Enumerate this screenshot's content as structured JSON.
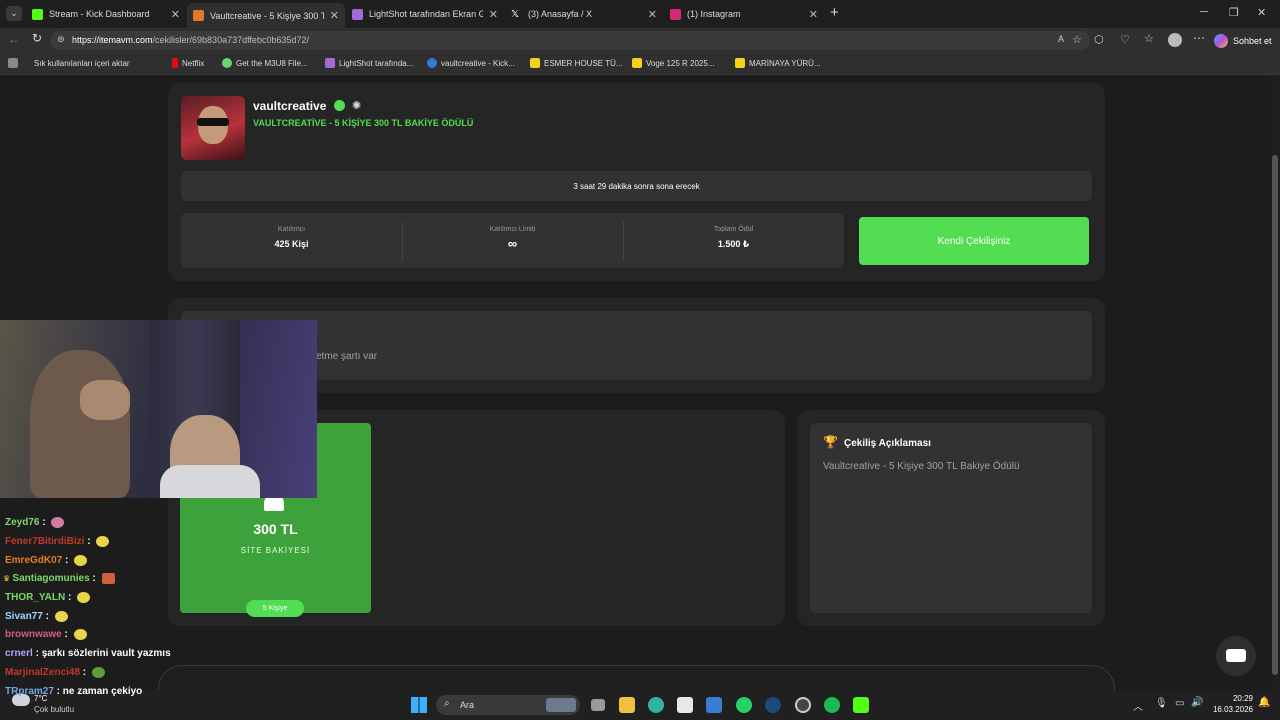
{
  "browser": {
    "tabs": [
      {
        "title": "Stream - Kick Dashboard",
        "color": "#53fc18"
      },
      {
        "title": "Vaultcreative - 5 Kişiye 300 TL Baki",
        "color": "#e07a2a"
      },
      {
        "title": "LightShot tarafından Ekran Görünt",
        "color": "#a36ad6"
      },
      {
        "title": "(3) Anasayfa / X",
        "color": "#ffffff"
      },
      {
        "title": "(1) Instagram",
        "color": "#d62976"
      }
    ],
    "new_tab": "+",
    "url_host": "https://itemavm.com",
    "url_path": "/cekilisler/69b830a737dffebc0b635d72/",
    "copilot": "Sohbet et",
    "bookmarks": [
      "Sık kullanılanları içeri aktar",
      "Netflix",
      "Get the M3U8 File...",
      "LightShot tarafında...",
      "vaultcreative - Kick...",
      "ESMER HOUSE TÜ...",
      "Voge 125 R 2025...",
      "MARİNAYA YÜRÜ..."
    ]
  },
  "giveaway": {
    "username": "vaultcreative",
    "subtitle": "VAULTCREATİVE - 5 KİŞİYE 300 TL BAKİYE ÖDÜLÜ",
    "countdown": "3 saat 29 dakika sonra sona erecek",
    "stats": [
      {
        "label": "Katılımcı",
        "value": "425 Kişi"
      },
      {
        "label": "Katılımcı Limiti",
        "value": "∞"
      },
      {
        "label": "Toplam Ödül",
        "value": "1.500 ₺"
      }
    ],
    "own_button": "Kendi Çekilişiniz",
    "requirement_text": "etme şartı var",
    "prize_amount": "300 TL",
    "prize_type": "SİTE BAKİYESİ",
    "prize_count": "5 Kişiye",
    "desc_title": "Çekiliş Açıklaması",
    "desc_text": "Vaultcreative - 5 Kişiye 300 TL Bakiye Ödülü"
  },
  "chat": [
    {
      "user": "Zeyd76",
      "msg": "",
      "color": "#7bd96a"
    },
    {
      "user": "Fener7BitirdiBizi",
      "msg": "",
      "color": "#c0392b"
    },
    {
      "user": "EmreGdK07",
      "msg": "",
      "color": "#e67e22"
    },
    {
      "user": "Santiagomunies",
      "msg": "",
      "color": "#7bd96a"
    },
    {
      "user": "THOR_YALN",
      "msg": "",
      "color": "#7bd96a"
    },
    {
      "user": "Sivan77",
      "msg": "",
      "color": "#9fd6ff"
    },
    {
      "user": "brownwawe",
      "msg": "",
      "color": "#d85a8f"
    },
    {
      "user": "crnerl",
      "msg": "şarkı sözlerini vault yazmıs",
      "color": "#b9a3ff"
    },
    {
      "user": "MarjinalZenci48",
      "msg": "",
      "color": "#c0392b"
    },
    {
      "user": "TRpram27",
      "msg": "ne zaman çekiyo",
      "color": "#6fa8dc"
    }
  ],
  "taskbar": {
    "weather_temp": "7°C",
    "weather_desc": "Çok bulutlu",
    "search": "Ara",
    "time": "20:29",
    "date": "16.03.2026"
  }
}
